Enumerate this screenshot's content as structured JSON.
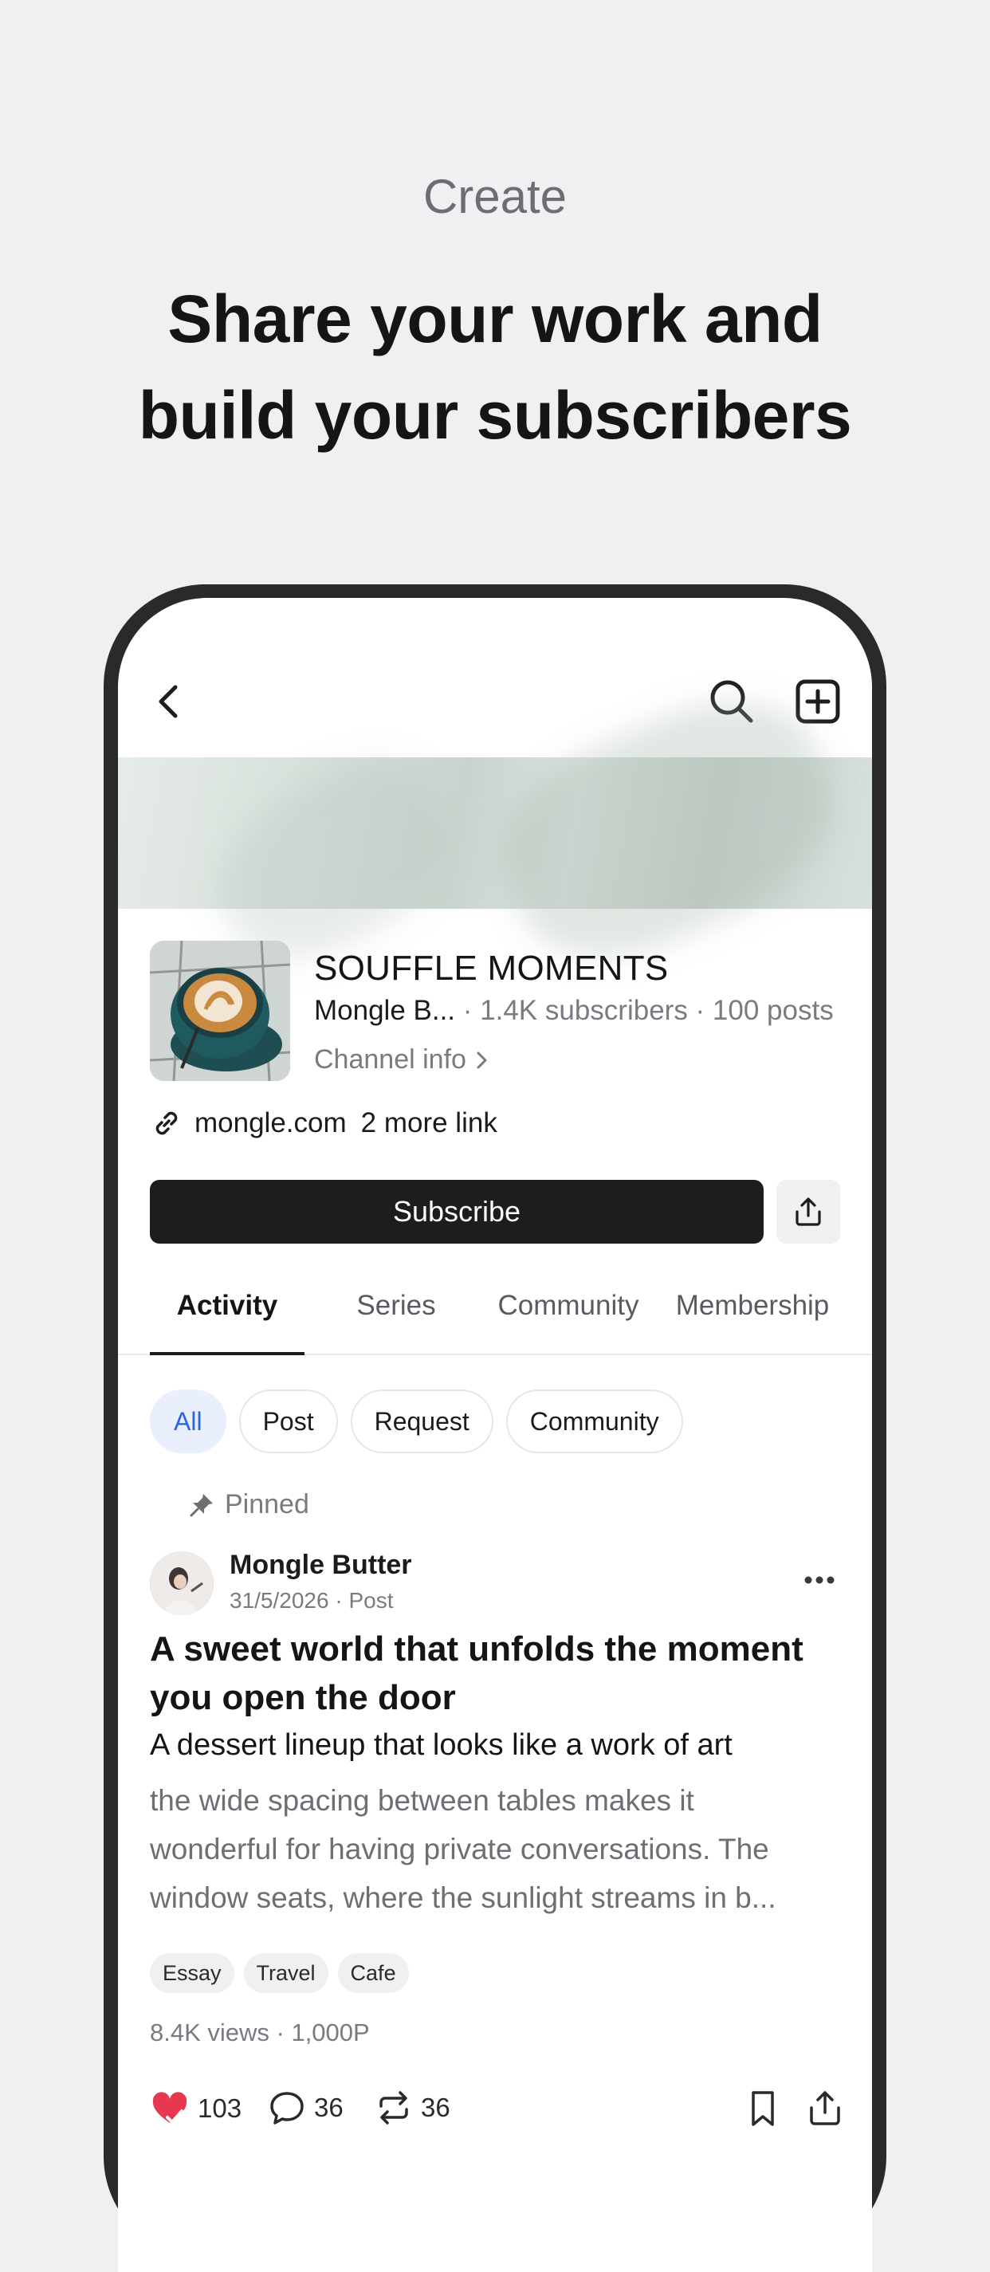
{
  "hero": {
    "subtitle": "Create",
    "title_line1": "Share your work and",
    "title_line2": "build your subscribers"
  },
  "channel": {
    "name": "SOUFFLE MOMENTS",
    "owner": "Mongle B...",
    "subscribers": " · 1.4K subscribers",
    "posts": " · 100 posts",
    "info_label": "Channel info",
    "link": "mongle.com",
    "more_links": "2 more link",
    "subscribe_label": "Subscribe"
  },
  "tabs": [
    {
      "label": "Activity",
      "active": true
    },
    {
      "label": "Series"
    },
    {
      "label": "Community"
    },
    {
      "label": "Membership"
    }
  ],
  "chips": [
    {
      "label": "All",
      "active": true
    },
    {
      "label": "Post"
    },
    {
      "label": "Request"
    },
    {
      "label": "Community"
    }
  ],
  "post": {
    "pinned_label": "Pinned",
    "author": "Mongle Butter",
    "meta": "31/5/2026 · Post",
    "title": "A sweet world that unfolds the moment you open the door",
    "subtitle": "A dessert lineup that looks like a work of art",
    "body_lines": [
      "the wide spacing between tables makes it",
      "wonderful for having private conversations. The",
      "window seats, where the sunlight streams in b..."
    ],
    "tags": [
      "Essay",
      "Travel",
      "Cafe"
    ],
    "stats": "8.4K views · 1,000P",
    "likes": "103",
    "comments": "36",
    "reposts": "36"
  },
  "colors": {
    "accent": "#2d66e0",
    "chip_active_bg": "#e9effc",
    "like": "#e8384f",
    "button_dark": "#1d1d1f"
  },
  "icons": [
    "back-arrow-icon",
    "search-icon",
    "add-box-icon",
    "chevron-right-icon",
    "link-icon",
    "share-icon",
    "pin-icon",
    "more-dots-icon",
    "heart-icon",
    "comment-icon",
    "repost-icon",
    "bookmark-icon"
  ]
}
